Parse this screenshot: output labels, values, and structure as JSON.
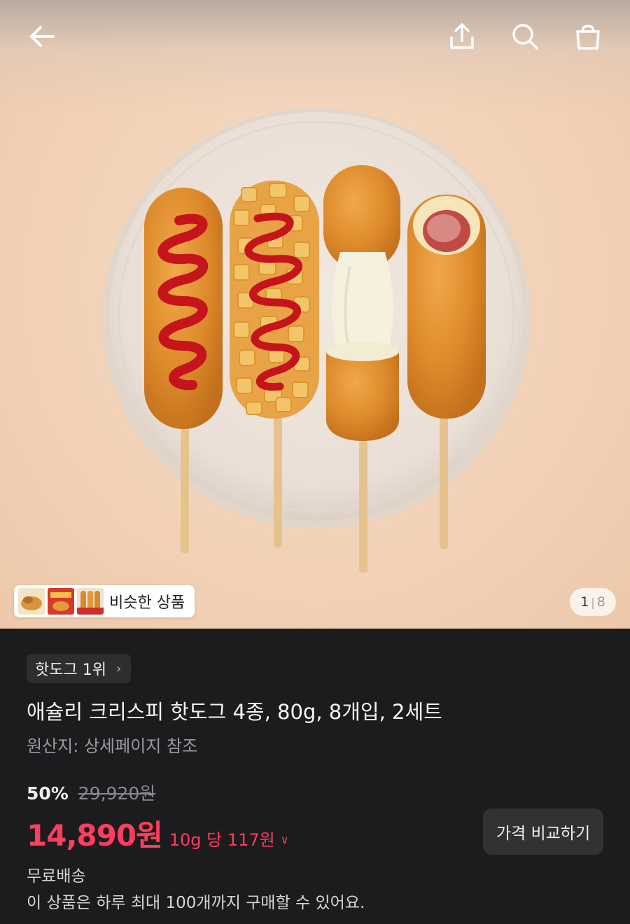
{
  "header": {
    "icons": [
      "back-arrow-icon",
      "share-icon",
      "search-icon",
      "cart-icon"
    ]
  },
  "gallery": {
    "similar_label": "비슷한 상품",
    "page_current": "1",
    "page_total": "8",
    "items": [
      "ketchup-hotdog",
      "potato-hotdog",
      "cheese-hotdog",
      "sausage-hotdog"
    ]
  },
  "product": {
    "rank_label": "핫도그 1위",
    "title": "애슐리 크리스피 핫도그 4종, 80g, 8개입, 2세트",
    "origin": "원산지: 상세페이지 참조",
    "discount": "50%",
    "original_price": "29,920원",
    "price": "14,890원",
    "unit_price": "10g 당 117원",
    "compare_button": "가격 비교하기",
    "shipping": "무료배송",
    "limit_notice": "이 상품은 하루 최대 100개까지 구매할 수 있어요."
  },
  "colors": {
    "accent_price": "#ff3d5e",
    "background": "#1c1c1e"
  }
}
